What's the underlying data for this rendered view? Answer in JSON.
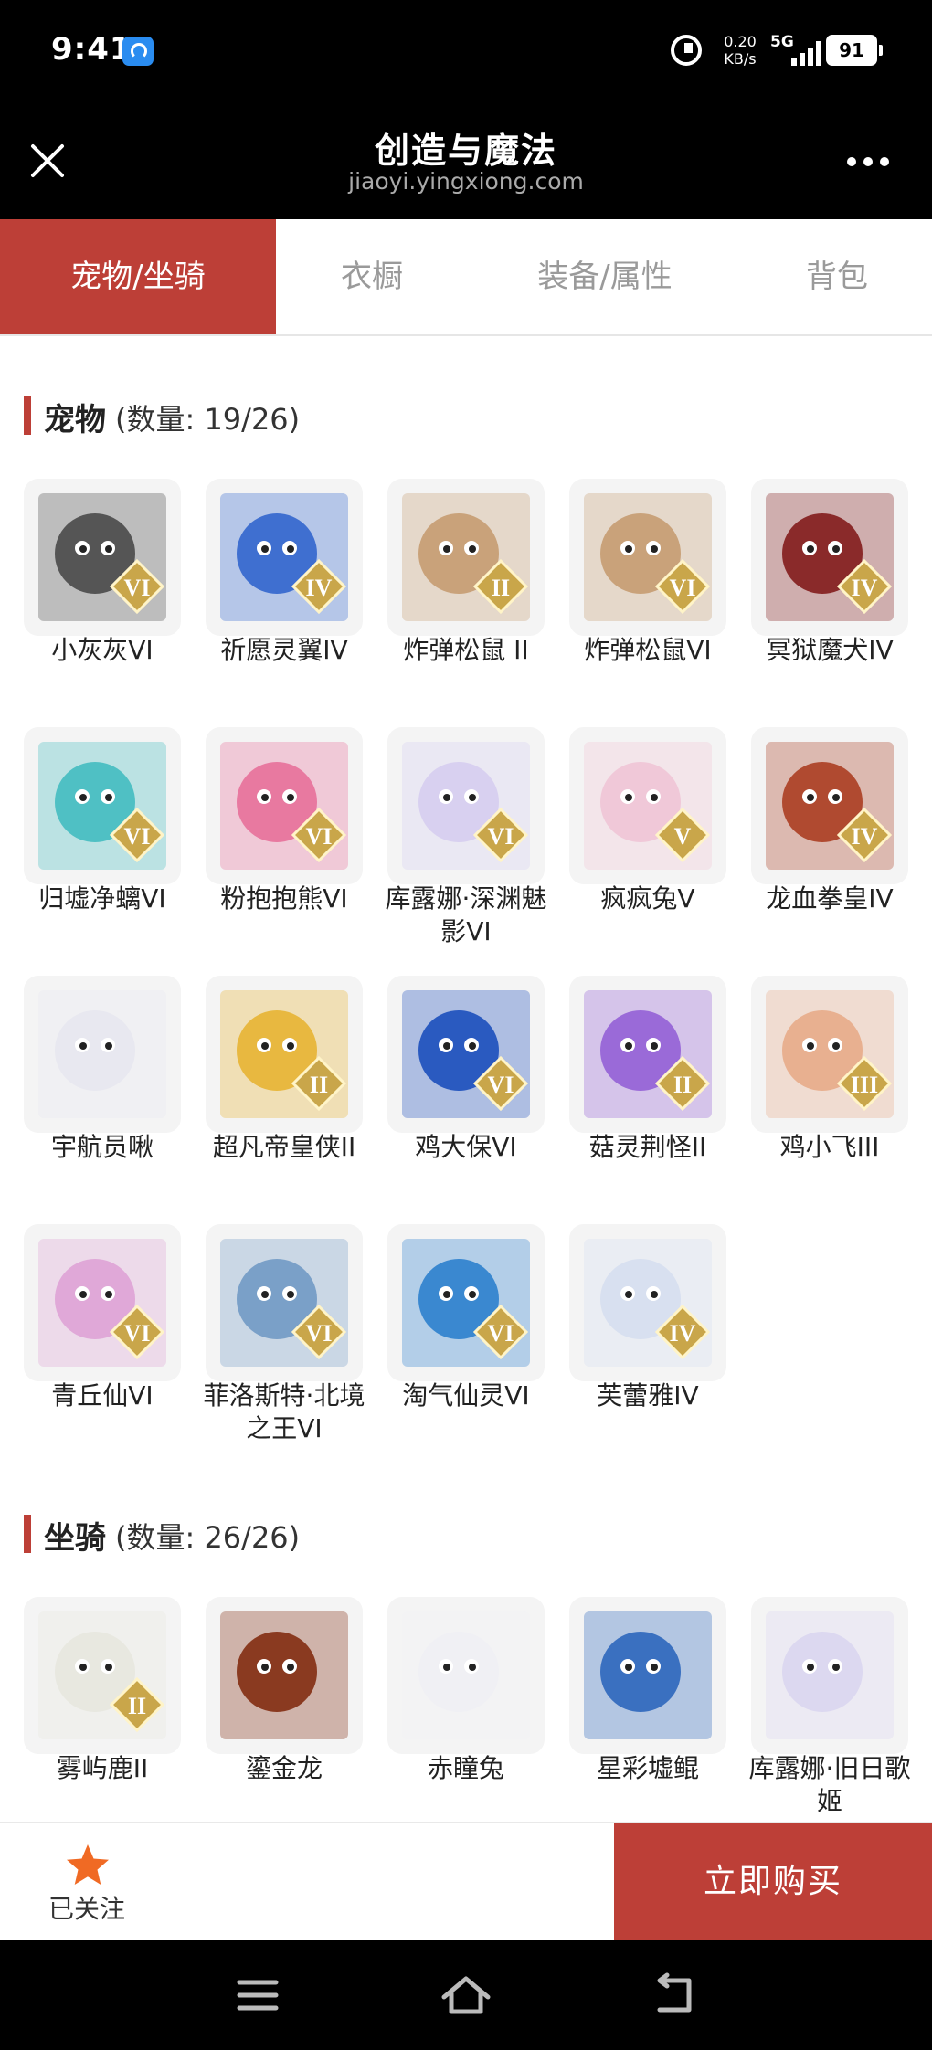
{
  "status_bar": {
    "time": "9:41",
    "speed_value": "0.20",
    "speed_unit": "KB/s",
    "network": "5G",
    "battery": "91"
  },
  "header": {
    "title": "创造与魔法",
    "subtitle": "jiaoyi.yingxiong.com"
  },
  "tabs": [
    {
      "label": "宠物/坐骑",
      "active": true
    },
    {
      "label": "衣橱",
      "active": false
    },
    {
      "label": "装备/属性",
      "active": false
    },
    {
      "label": "背包",
      "active": false
    }
  ],
  "sections": {
    "pets": {
      "title": "宠物",
      "count": "(数量: 19/26)",
      "items": [
        {
          "name": "小灰灰VI",
          "badge": "VI",
          "color": "#555555"
        },
        {
          "name": "祈愿灵翼IV",
          "badge": "IV",
          "color": "#3f6fd0"
        },
        {
          "name": "炸弹松鼠 II",
          "badge": "II",
          "color": "#c9a27a"
        },
        {
          "name": "炸弹松鼠VI",
          "badge": "VI",
          "color": "#c9a27a"
        },
        {
          "name": "冥狱魔犬IV",
          "badge": "IV",
          "color": "#8a2a2a"
        },
        {
          "name": "归墟净螭VI",
          "badge": "VI",
          "color": "#4fc0c4"
        },
        {
          "name": "粉抱抱熊VI",
          "badge": "VI",
          "color": "#e879a0"
        },
        {
          "name": "库露娜·深渊魅影VI",
          "badge": "VI",
          "color": "#d8d0f0"
        },
        {
          "name": "疯疯兔V",
          "badge": "V",
          "color": "#f0c8d8"
        },
        {
          "name": "龙血拳皇IV",
          "badge": "IV",
          "color": "#b04a30"
        },
        {
          "name": "宇航员啾",
          "badge": "",
          "color": "#e8e8f0"
        },
        {
          "name": "超凡帝皇侠II",
          "badge": "II",
          "color": "#e8b840"
        },
        {
          "name": "鸡大保VI",
          "badge": "VI",
          "color": "#2a5ac0"
        },
        {
          "name": "菇灵荆怪II",
          "badge": "II",
          "color": "#9a6ad8"
        },
        {
          "name": "鸡小飞III",
          "badge": "III",
          "color": "#e8b090"
        },
        {
          "name": "青丘仙VI",
          "badge": "VI",
          "color": "#e0a8d8"
        },
        {
          "name": "菲洛斯特·北境之王VI",
          "badge": "VI",
          "color": "#7aa0c8"
        },
        {
          "name": "淘气仙灵VI",
          "badge": "VI",
          "color": "#3a88d0"
        },
        {
          "name": "芙蕾雅IV",
          "badge": "IV",
          "color": "#d8e0f0"
        }
      ]
    },
    "mounts": {
      "title": "坐骑",
      "count": "(数量: 26/26)",
      "items": [
        {
          "name": "雾屿鹿II",
          "badge": "II",
          "color": "#e8e8e0"
        },
        {
          "name": "鎏金龙",
          "badge": "",
          "color": "#8a3a20"
        },
        {
          "name": "赤瞳兔",
          "badge": "",
          "color": "#f0f0f4"
        },
        {
          "name": "星彩墟鲲",
          "badge": "",
          "color": "#3a70c0"
        },
        {
          "name": "库露娜·旧日歌姬",
          "badge": "",
          "color": "#dcd8f0"
        }
      ]
    }
  },
  "bottom_bar": {
    "follow_label": "已关注",
    "buy_label": "立即购买"
  },
  "icons": {
    "close": "close-icon",
    "more": "more-icon",
    "star": "star-icon",
    "menu": "menu-icon",
    "home": "home-icon",
    "back": "back-icon"
  },
  "colors": {
    "accent": "#bd3f37",
    "star": "#f06a24"
  }
}
